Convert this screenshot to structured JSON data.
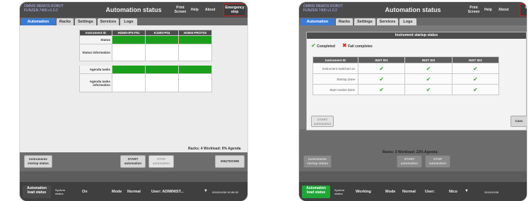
{
  "left": {
    "header": {
      "app_name": "OMNIS MEMOS ROBOT FUNZEN 7400 v1.0.2",
      "title": "Automation status",
      "print_screen": "Print Screen",
      "help": "Help",
      "about": "About",
      "emergency_stop": "Emergency stop"
    },
    "tabs": [
      "Automation status",
      "Racks",
      "Settings",
      "Services",
      "Logs"
    ],
    "table": {
      "header_label": "Instrument ID",
      "columns": [
        "H2500-IPS-FIU",
        "K1500-P04",
        "H2500-PROT02"
      ],
      "rows": [
        "Status",
        "Status information",
        "",
        "Agenda tasks",
        "Agenda tasks information"
      ]
    },
    "status_text": "Racks: 4  Workload: 0%  Agenda",
    "buttons": {
      "instruments_startup": "Instruments startup status",
      "start": "START automation",
      "stop": "STOP automation",
      "shutdown": "SHUTDOWN"
    },
    "footer": {
      "mode_label": "Automation",
      "mode_sub": "load status",
      "system_label": "System status",
      "system_value": "On",
      "mode": "Mode",
      "mode_value": "Normal",
      "user": "User: ADMINIST...",
      "datetime": "2024/12/08 16:38:02"
    }
  },
  "right": {
    "header": {
      "app_name": "OMNIS MEMOS ROBOT FUNZEN 7400 v1.0.2",
      "title": "Automation status",
      "print_screen": "Print Screen",
      "help": "Help",
      "about": "About",
      "emergency_stop": "Em"
    },
    "tabs": [
      "Automation status",
      "Racks",
      "Settings",
      "Services",
      "Logs"
    ],
    "modal": {
      "title": "Instrument startup status",
      "legend_completed": "Completed",
      "legend_failed": "Fail completes",
      "columns": [
        "Instrument ID",
        "INST ID1",
        "INST ID2",
        "INST ID3"
      ],
      "rows": [
        "Instrument switched on",
        "Startup done",
        "Start routine done"
      ],
      "start_btn": "START automation",
      "cancel_btn": "Canc"
    },
    "status_text": "Racks: 3  Workload: 23%  Agenda:",
    "buttons": {
      "instruments_startup": "Instruments startup status",
      "start": "START automation",
      "stop": "STOP automation"
    },
    "footer": {
      "mode_label": "Automation",
      "mode_sub": "load status",
      "system_label": "System status",
      "system_value": "Working",
      "mode": "Mode",
      "mode_value": "Normal",
      "user": "User:",
      "user_value": "Nico",
      "datetime": "2024/12/08"
    },
    "colors": {
      "accent": "#3a7bd5",
      "ok": "#1b9e1b",
      "completed_check": "#3aa335",
      "fail": "#d02020",
      "estop": "#d32020"
    }
  }
}
